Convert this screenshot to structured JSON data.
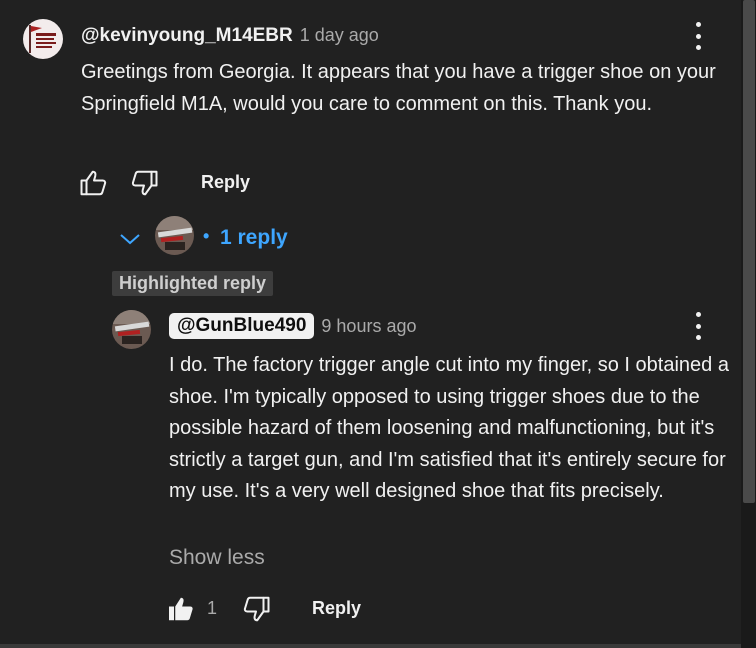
{
  "comment": {
    "handle": "@kevinyoung_M14EBR",
    "time": "1 day ago",
    "text": "Greetings from Georgia. It appears that you have a trigger shoe on your Springfield M1A, would you care to comment on this. Thank you.",
    "avatar_icon": "avatar-flag-icon",
    "reply_label": "Reply",
    "replies_toggle": {
      "dot": "•",
      "label": "1 reply"
    }
  },
  "highlighted_reply": {
    "badge": "Highlighted reply",
    "handle": "@GunBlue490",
    "time": "9 hours ago",
    "text": "I do.  The factory trigger angle cut into my finger, so I obtained a shoe.  I'm typically opposed to using trigger shoes due to the possible hazard of them loosening and malfunctioning, but it's strictly a target gun, and I'm satisfied that it's entirely secure for my use.  It's a very well designed shoe that fits precisely.",
    "show_less": "Show less",
    "like_count": "1",
    "reply_label": "Reply",
    "liked": true
  },
  "colors": {
    "background": "#212121",
    "text": "#f1f1f1",
    "muted": "#aaaaaa",
    "link_blue": "#3ea6ff"
  }
}
